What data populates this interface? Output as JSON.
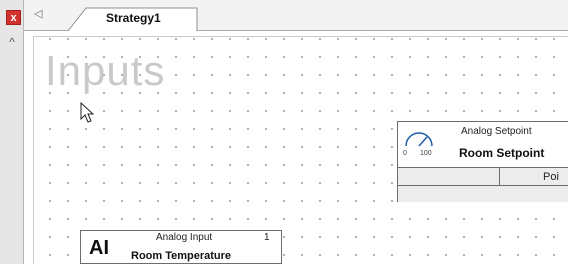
{
  "window": {
    "close_glyph": "x",
    "collapse_glyph": "^"
  },
  "tabs": {
    "nav_glyph": "◁",
    "active_label": "Strategy1"
  },
  "canvas": {
    "section_title": "Inputs",
    "blocks": {
      "analog_input": {
        "badge": "AI",
        "type_label": "Analog Input",
        "number": "1",
        "name": "Room Temperature"
      },
      "analog_setpoint": {
        "type_label": "Analog Setpoint",
        "name": "Room Setpoint",
        "gauge_min": "0",
        "gauge_max": "100",
        "row_label": "Poi"
      }
    }
  },
  "icons": [
    "close-icon",
    "chevron-up-icon",
    "tab-back-icon",
    "pointer-cursor-icon",
    "gauge-icon"
  ]
}
